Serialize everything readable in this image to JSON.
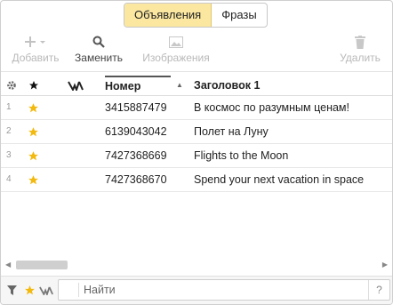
{
  "tabs": [
    {
      "label": "Объявления",
      "active": true
    },
    {
      "label": "Фразы",
      "active": false
    }
  ],
  "toolbar": {
    "add": {
      "label": "Добавить",
      "icon": "plus-icon",
      "enabled": false
    },
    "replace": {
      "label": "Заменить",
      "icon": "search-icon",
      "enabled": true
    },
    "images": {
      "label": "Изображения",
      "icon": "image-icon",
      "enabled": false
    },
    "delete": {
      "label": "Удалить",
      "icon": "trash-icon",
      "enabled": false
    }
  },
  "grid": {
    "columns": {
      "settings_icon": "gear-icon",
      "star_icon": "star-icon",
      "extra_icon": "bird-icon",
      "number": "Номер",
      "title": "Заголовок 1"
    },
    "rows": [
      {
        "index": "1",
        "starred": true,
        "number": "3415887479",
        "title": "В космос по разумным ценам!"
      },
      {
        "index": "2",
        "starred": true,
        "number": "6139043042",
        "title": "Полет на Луну"
      },
      {
        "index": "3",
        "starred": true,
        "number": "7427368669",
        "title": "Flights to the Moon"
      },
      {
        "index": "4",
        "starred": true,
        "number": "7427368670",
        "title": "Spend your next vacation in space"
      }
    ]
  },
  "footer": {
    "search_placeholder": "Найти",
    "help_label": "?"
  },
  "colors": {
    "tab_active_bg": "#fbe7a0",
    "star": "#f2b90f"
  }
}
